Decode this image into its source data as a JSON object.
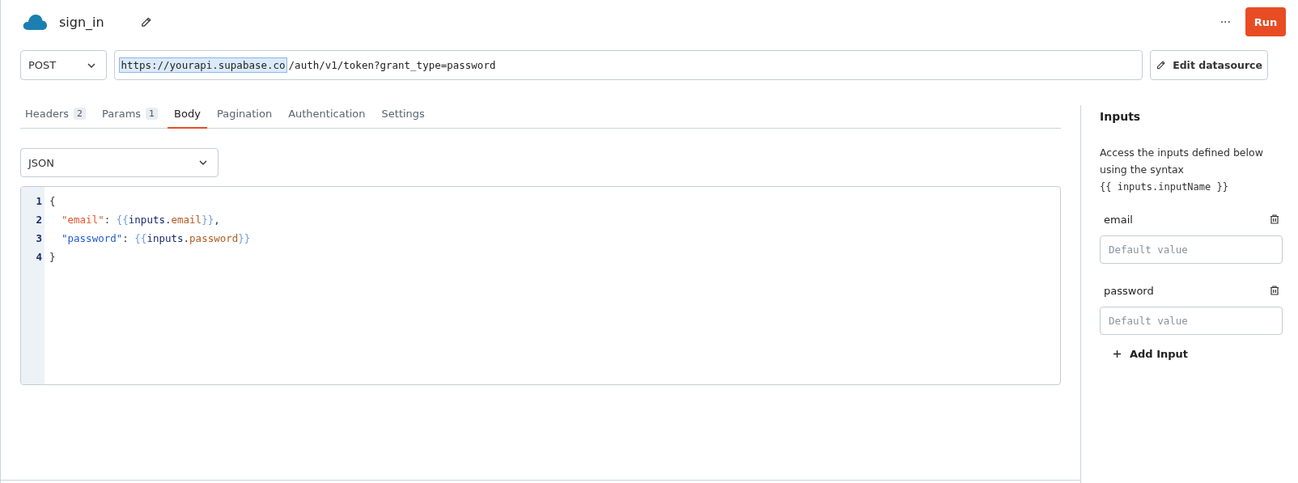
{
  "query": {
    "name": "sign_in"
  },
  "actions": {
    "more": "···",
    "run": "Run"
  },
  "request": {
    "method": "POST",
    "url_base": "https://yourapi.supabase.co",
    "url_base_selected": true,
    "url_path": "/auth/v1/token?grant_type=password",
    "edit_button": "Edit datasource"
  },
  "tabs": [
    {
      "label": "Headers",
      "count": "2",
      "selected": false
    },
    {
      "label": "Params",
      "count": "1",
      "selected": false
    },
    {
      "label": "Body",
      "selected": true
    },
    {
      "label": "Pagination",
      "selected": false
    },
    {
      "label": "Authentication",
      "selected": false
    },
    {
      "label": "Settings",
      "selected": false
    }
  ],
  "body": {
    "format": "JSON",
    "lines": [
      {
        "number": "1",
        "tokens": [
          {
            "kind": "punct",
            "text": "{"
          }
        ]
      },
      {
        "number": "2",
        "indented": true,
        "tokens": [
          {
            "kind": "key",
            "text": "\"email\""
          },
          {
            "kind": "punct",
            "text": ": "
          },
          {
            "kind": "brace",
            "text": "{{"
          },
          {
            "kind": "ident",
            "text": "inputs."
          },
          {
            "kind": "prop",
            "text": "email"
          },
          {
            "kind": "brace",
            "text": "}}"
          },
          {
            "kind": "punct",
            "text": ","
          }
        ]
      },
      {
        "number": "3",
        "indented": true,
        "tokens": [
          {
            "kind": "key2",
            "text": "\"password\""
          },
          {
            "kind": "punct",
            "text": ": "
          },
          {
            "kind": "brace",
            "text": "{{"
          },
          {
            "kind": "ident",
            "text": "inputs."
          },
          {
            "kind": "prop",
            "text": "password"
          },
          {
            "kind": "brace",
            "text": "}}"
          }
        ]
      },
      {
        "number": "4",
        "tokens": [
          {
            "kind": "punct",
            "text": "}"
          }
        ]
      }
    ]
  },
  "inputs_panel": {
    "title": "Inputs",
    "description": "Access the inputs defined below using the syntax",
    "syntax": "{{ inputs.inputName }}",
    "inputs": [
      {
        "name": "email",
        "placeholder": "Default value"
      },
      {
        "name": "password",
        "placeholder": "Default value"
      }
    ],
    "add_button": "Add Input"
  }
}
